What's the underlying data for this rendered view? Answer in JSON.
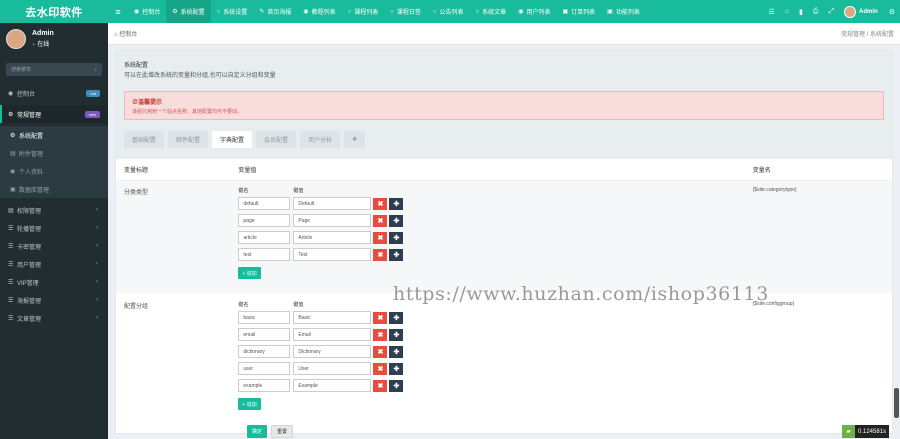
{
  "app": {
    "logo": "去水印软件"
  },
  "topnav": {
    "items": [
      {
        "icon": "◉",
        "label": "控制台"
      },
      {
        "icon": "⚙",
        "label": "系统配置"
      },
      {
        "icon": "○",
        "label": "系统设置"
      },
      {
        "icon": "✎",
        "label": "首页海报"
      },
      {
        "icon": "◉",
        "label": "教程列表"
      },
      {
        "icon": "○",
        "label": "课程列表"
      },
      {
        "icon": "○",
        "label": "课程日签"
      },
      {
        "icon": "○",
        "label": "公告列表"
      },
      {
        "icon": "○",
        "label": "系统文章"
      },
      {
        "icon": "◉",
        "label": "用户列表"
      },
      {
        "icon": "▣",
        "label": "订单列表"
      },
      {
        "icon": "▣",
        "label": "功能列表"
      }
    ],
    "right_icons": [
      "☰",
      "⌂",
      "▮",
      "⎙",
      "⤢"
    ],
    "username": "Admin",
    "settings_icon": "⚙"
  },
  "sidebar": {
    "user": {
      "name": "Admin",
      "status": "在线"
    },
    "search_placeholder": "搜索菜单",
    "items": [
      {
        "icon": "◉",
        "label": "控制台",
        "badge": "hot",
        "badge_color": "#3c8dbc"
      },
      {
        "icon": "⚙",
        "label": "常规管理",
        "badge": "new",
        "badge_color": "#7e57c2"
      },
      {
        "icon": "⚙",
        "label": "系统配置"
      },
      {
        "icon": "▤",
        "label": "附件管理"
      },
      {
        "icon": "◉",
        "label": "个人资料"
      },
      {
        "icon": "▣",
        "label": "数据库管理"
      },
      {
        "icon": "▤",
        "label": "权限管理"
      },
      {
        "icon": "☰",
        "label": "轮播管理"
      },
      {
        "icon": "☰",
        "label": "卡密管理"
      },
      {
        "icon": "☰",
        "label": "用户管理"
      },
      {
        "icon": "☰",
        "label": "VIP管理"
      },
      {
        "icon": "☰",
        "label": "海报管理"
      },
      {
        "icon": "☰",
        "label": "文章管理"
      }
    ]
  },
  "breadcrumb": {
    "home": "控制台",
    "path": "常规管理 / 系统配置"
  },
  "panel": {
    "title": "系统配置",
    "description": "可以在此增改系统的变量和分组,也可以自定义分组和变量",
    "alert_title": "⊘温馨提示",
    "alert_body": "该组只用到一个站点名称，其他配置均可不要动。",
    "tabs": [
      "基础配置",
      "邮件配置",
      "字典配置",
      "会员配置",
      "用户分析",
      "✚"
    ],
    "active_tab": 2
  },
  "table": {
    "headers": {
      "title": "变量标题",
      "value": "变量值",
      "name": "变量名"
    },
    "key_label": "键名",
    "value_label": "键值",
    "add_label": "+ 追加",
    "rows": [
      {
        "title": "分类类型",
        "var_name": "{$site.categorytype}",
        "pairs": [
          {
            "k": "default",
            "v": "Default"
          },
          {
            "k": "page",
            "v": "Page"
          },
          {
            "k": "article",
            "v": "Article"
          },
          {
            "k": "test",
            "v": "Test"
          }
        ]
      },
      {
        "title": "配置分组",
        "var_name": "{$site.configgroup}",
        "pairs": [
          {
            "k": "basic",
            "v": "Basic"
          },
          {
            "k": "email",
            "v": "Email"
          },
          {
            "k": "dictionary",
            "v": "Dictionary"
          },
          {
            "k": "user",
            "v": "User"
          },
          {
            "k": "example",
            "v": "Example"
          }
        ]
      }
    ]
  },
  "buttons": {
    "ok": "确定",
    "reset": "重置",
    "del_glyph": "✖",
    "drag_glyph": "✚"
  },
  "watermark": "https://www.huzhan.com/ishop36113",
  "timer": {
    "value": "0.124581s"
  }
}
